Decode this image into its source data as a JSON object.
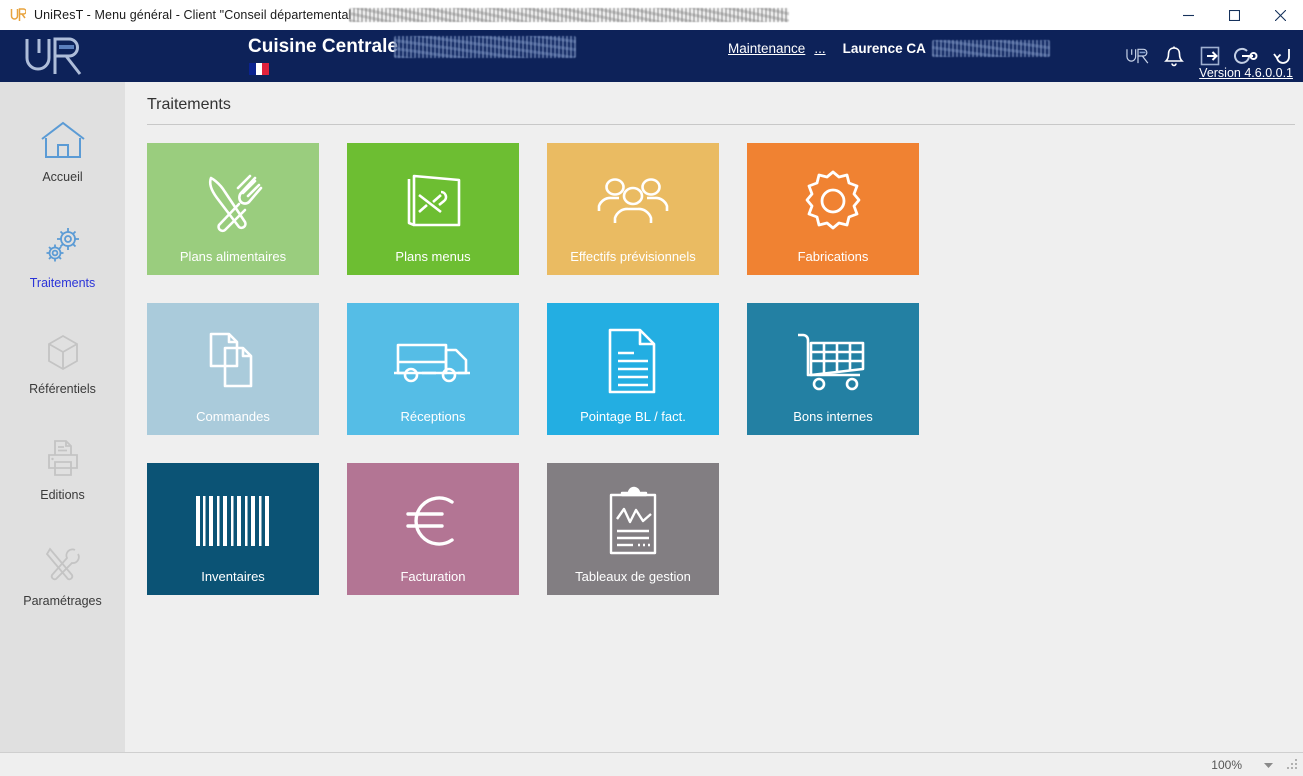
{
  "window": {
    "app_icon": "ur-logo-icon",
    "title_text": "UniResT - Menu général - Client \"Conseil départemental ",
    "title_redacted": true,
    "minimize_label": "Minimize",
    "maximize_label": "Maximize",
    "close_label": "Close"
  },
  "header": {
    "logo": "ur-logo-icon",
    "site_title": "Cuisine Centrale",
    "site_title_redacted": true,
    "flag": "french-flag-icon",
    "maintenance_link": "Maintenance",
    "more_link": "...",
    "user_name": "Laurence CA",
    "user_name_redacted": true,
    "version": "Version 4.6.0.0.1",
    "icons": [
      {
        "name": "bell-icon",
        "label": "Notifications"
      },
      {
        "name": "logout-icon",
        "label": "Déconnexion"
      },
      {
        "name": "key-icon",
        "label": "Droits"
      },
      {
        "name": "refresh-icon",
        "label": "Rafraîchir"
      }
    ],
    "bg_color": "#0d2259"
  },
  "sidebar": {
    "items": [
      {
        "label": "Accueil",
        "icon": "home-icon",
        "active": false,
        "accent": "#5b9bd5"
      },
      {
        "label": "Traitements",
        "icon": "gears-icon",
        "active": true,
        "accent": "#5b9bd5"
      },
      {
        "label": "Référentiels",
        "icon": "cube-icon",
        "active": false,
        "accent": "#c9c9c9"
      },
      {
        "label": "Editions",
        "icon": "printer-icon",
        "active": false,
        "accent": "#c9c9c9"
      },
      {
        "label": "Paramétrages",
        "icon": "tools-icon",
        "active": false,
        "accent": "#c9c9c9"
      }
    ]
  },
  "main": {
    "page_title": "Traitements",
    "tiles": [
      {
        "label": "Plans alimentaires",
        "icon": "cutlery-icon",
        "color": "#9ACD7E"
      },
      {
        "label": "Plans menus",
        "icon": "menu-book-icon",
        "color": "#6DBE32"
      },
      {
        "label": "Effectifs prévisionnels",
        "icon": "people-icon",
        "color": "#EABB62"
      },
      {
        "label": "Fabrications",
        "icon": "gear-icon",
        "color": "#F08232"
      },
      {
        "label": "Commandes",
        "icon": "documents-icon",
        "color": "#AACBDB"
      },
      {
        "label": "Réceptions",
        "icon": "truck-icon",
        "color": "#55BDE6"
      },
      {
        "label": "Pointage BL / fact.",
        "icon": "document-icon",
        "color": "#23AEE2"
      },
      {
        "label": "Bons internes",
        "icon": "cart-icon",
        "color": "#2380A3"
      },
      {
        "label": "Inventaires",
        "icon": "barcode-icon",
        "color": "#0B5375"
      },
      {
        "label": "Facturation",
        "icon": "euro-icon",
        "color": "#B37594"
      },
      {
        "label": "Tableaux de gestion",
        "icon": "clipboard-chart-icon",
        "color": "#827E82"
      }
    ]
  },
  "statusbar": {
    "zoom": "100%",
    "zoom_caret": "chevron-down-icon",
    "grip": "resize-grip-icon"
  }
}
